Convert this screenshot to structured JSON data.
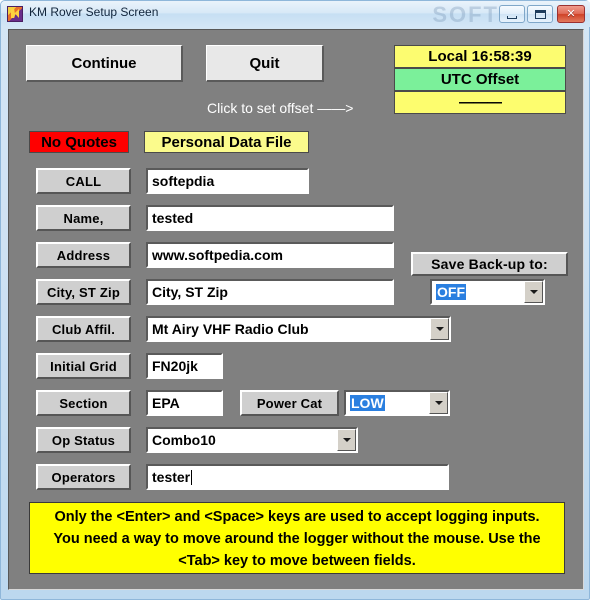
{
  "window": {
    "title": "KM Rover Setup Screen",
    "icon": "app-icon",
    "watermark": "SOFT",
    "watermark_url": "www.softpedia.com",
    "controls": {
      "minimize": "minimize-icon",
      "maximize": "maximize-icon",
      "close": "close-icon"
    }
  },
  "toolbar": {
    "continue_label": "Continue",
    "quit_label": "Quit"
  },
  "clock": {
    "local_label": "Local 16:58:39",
    "utc_offset_label": "UTC  Offset",
    "offset_value": "———",
    "hint": "Click to set offset ——>",
    "colors": {
      "local_bg": "#fcfc70",
      "utc_bg": "#7bf09a",
      "offset_bg": "#fdfd6e"
    }
  },
  "status": {
    "quotes_label": "No Quotes",
    "quotes_color": "#ff0000",
    "data_file_label": "Personal Data File",
    "data_file_color": "#fbfb8c"
  },
  "backup": {
    "title": "Save Back-up to:",
    "value": "OFF",
    "selected": true
  },
  "power": {
    "label": "Power Cat",
    "value": "LOW",
    "selected": true
  },
  "fields": [
    {
      "label": "CALL",
      "value": "softepdia",
      "type": "text"
    },
    {
      "label": "Name,",
      "value": "tested",
      "type": "text"
    },
    {
      "label": "Address",
      "value": "www.softpedia.com",
      "type": "text"
    },
    {
      "label": "City, ST Zip",
      "value": "City, ST Zip",
      "type": "text"
    },
    {
      "label": "Club Affil.",
      "value": "Mt Airy VHF Radio Club",
      "type": "combo"
    },
    {
      "label": "Initial Grid",
      "value": "FN20jk",
      "type": "text"
    },
    {
      "label": "Section",
      "value": "EPA",
      "type": "text"
    },
    {
      "label": "Op Status",
      "value": "Combo10",
      "type": "combo"
    },
    {
      "label": "Operators",
      "value": "tester",
      "type": "text"
    }
  ],
  "note": {
    "text": "Only the <Enter> and <Space> keys are used to accept logging inputs. You need a way to move around the logger without the mouse. Use the <Tab> key to move between fields.",
    "bg_color": "#ffff00"
  }
}
